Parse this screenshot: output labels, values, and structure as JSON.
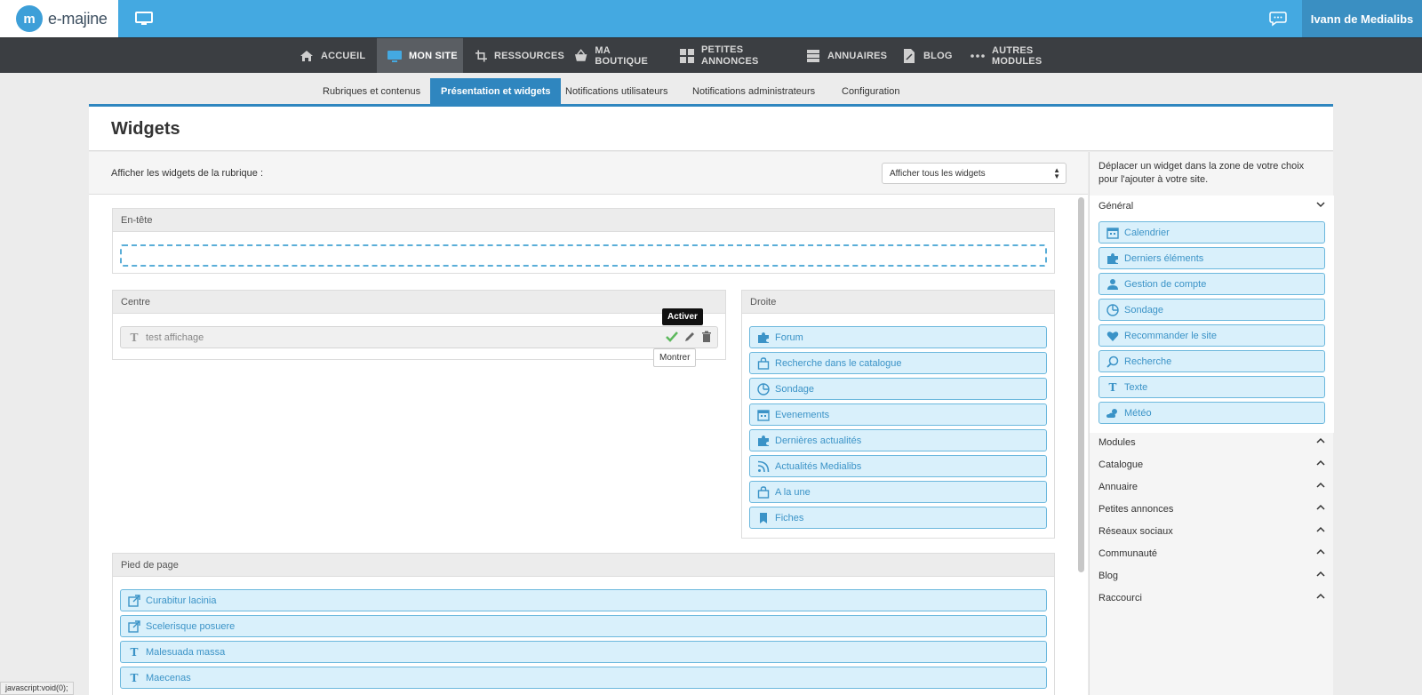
{
  "app": {
    "brand": "e-majine",
    "logo_glyph": "m",
    "user_name": "Ivann de Medialibs"
  },
  "nav": [
    {
      "label": "ACCUEIL",
      "icon": "home-icon"
    },
    {
      "label": "MON SITE",
      "icon": "monitor-icon",
      "active": true
    },
    {
      "label": "RESSOURCES",
      "icon": "crop-icon"
    },
    {
      "label": "MA BOUTIQUE",
      "icon": "basket-icon"
    },
    {
      "label": "PETITES ANNONCES",
      "icon": "grid-icon"
    },
    {
      "label": "ANNUAIRES",
      "icon": "stack-icon"
    },
    {
      "label": "BLOG",
      "icon": "document-icon"
    },
    {
      "label": "AUTRES MODULES",
      "icon": "dots-icon"
    }
  ],
  "subnav": [
    {
      "label": "Rubriques et contenus"
    },
    {
      "label": "Présentation et widgets",
      "active": true
    },
    {
      "label": "Notifications utilisateurs"
    },
    {
      "label": "Notifications administrateurs"
    },
    {
      "label": "Configuration"
    }
  ],
  "page": {
    "title": "Widgets",
    "filter_label": "Afficher les widgets de la rubrique :",
    "filter_value": "Afficher tous les widgets"
  },
  "zones": {
    "header": {
      "title": "En-tête"
    },
    "center": {
      "title": "Centre",
      "widgets": [
        {
          "label": "test affichage",
          "icon": "text-icon"
        }
      ],
      "tooltip_top": "Activer",
      "tooltip_bottom": "Montrer"
    },
    "right": {
      "title": "Droite",
      "widgets": [
        {
          "label": "Forum",
          "icon": "puzzle-icon"
        },
        {
          "label": "Recherche dans le catalogue",
          "icon": "bag-icon"
        },
        {
          "label": "Sondage",
          "icon": "pie-icon"
        },
        {
          "label": "Evenements",
          "icon": "calendar-icon"
        },
        {
          "label": "Dernières actualités",
          "icon": "puzzle-icon"
        },
        {
          "label": "Actualités Medialibs",
          "icon": "rss-icon"
        },
        {
          "label": "A la une",
          "icon": "bag-icon"
        },
        {
          "label": "Fiches",
          "icon": "bookmark-icon"
        }
      ]
    },
    "footer": {
      "title": "Pied de page",
      "widgets": [
        {
          "label": "Curabitur lacinia",
          "icon": "external-link-icon"
        },
        {
          "label": "Scelerisque posuere",
          "icon": "external-link-icon"
        },
        {
          "label": "Malesuada massa",
          "icon": "text-icon"
        },
        {
          "label": "Maecenas",
          "icon": "text-icon"
        }
      ]
    }
  },
  "sidebar": {
    "help": "Déplacer un widget dans la zone de votre choix pour l'ajouter à votre site.",
    "general": {
      "title": "Général",
      "widgets": [
        {
          "label": "Calendrier",
          "icon": "calendar-icon"
        },
        {
          "label": "Derniers éléments",
          "icon": "puzzle-icon"
        },
        {
          "label": "Gestion de compte",
          "icon": "user-icon"
        },
        {
          "label": "Sondage",
          "icon": "pie-icon"
        },
        {
          "label": "Recommander le site",
          "icon": "heart-icon"
        },
        {
          "label": "Recherche",
          "icon": "search-icon"
        },
        {
          "label": "Texte",
          "icon": "text-icon"
        },
        {
          "label": "Météo",
          "icon": "weather-icon"
        }
      ]
    },
    "sections": [
      {
        "label": "Modules"
      },
      {
        "label": "Catalogue"
      },
      {
        "label": "Annuaire"
      },
      {
        "label": "Petites annonces"
      },
      {
        "label": "Réseaux sociaux"
      },
      {
        "label": "Communauté"
      },
      {
        "label": "Blog"
      },
      {
        "label": "Raccourci"
      }
    ]
  },
  "status_bar": "javascript:void(0);"
}
